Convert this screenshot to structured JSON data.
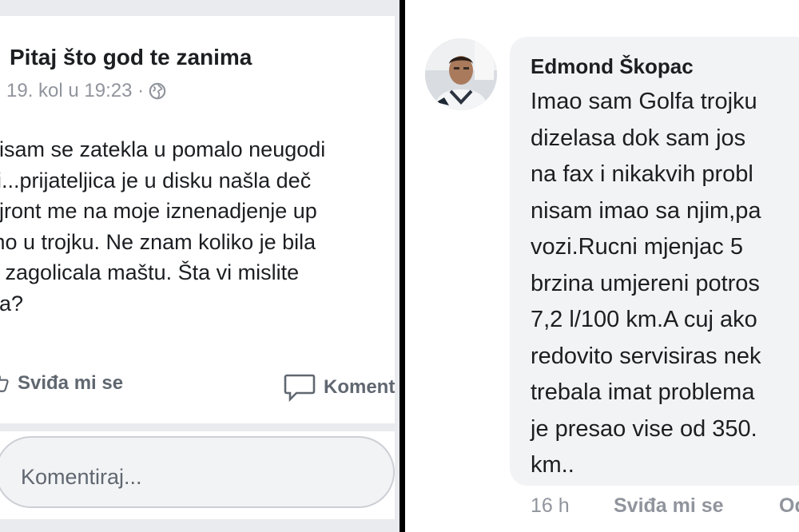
{
  "colors": {
    "divider": "#000000",
    "text": "#1c1e21",
    "meta": "#90949c",
    "bubble": "#f2f3f5",
    "panel_bg": "#e9ebee"
  },
  "left": {
    "page_title": "Pitaj što god te zanima",
    "timestamp": "19. kol u 19:23 ·",
    "privacy_icon": "globe-icon",
    "body_lines": [
      "nisam se zatekla u pomalo neugodi",
      "iji...prijateljica je u disku našla deč",
      "ajront me na moje iznenadjenje up",
      "mo u trojku. Ne znam koliko je bila",
      "e zagolicala maštu. Šta vi mislite",
      "na?"
    ],
    "like_label": "Sviđa mi se",
    "like_icon": "thumbs-up-icon",
    "comment_label": "Koment",
    "comment_icon": "speech-bubble-icon",
    "comment_placeholder": "Komentiraj..."
  },
  "right": {
    "author": "Edmond Škopac",
    "avatar_icon": "profile-photo",
    "comment_lines": [
      "Imao sam Golfa trojku",
      "dizelasa dok sam jos",
      "na fax i nikakvih probl",
      "nisam imao sa njim,pa",
      "vozi.Rucni mjenjac 5",
      "brzina umjereni potros",
      "7,2 l/100 km.A cuj ako",
      "redovito servisiras nek",
      "trebala imat problema",
      "je presao vise od 350.",
      "km.."
    ],
    "time": "16 h",
    "like_label": "Sviđa mi se",
    "reply_label": "Od"
  }
}
